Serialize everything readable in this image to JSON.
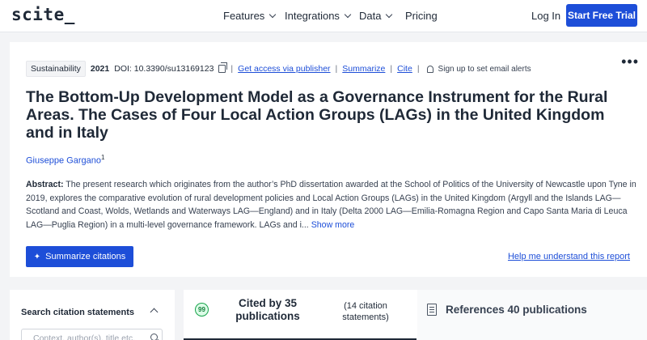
{
  "nav": {
    "logo": "scite_",
    "items": [
      {
        "label": "Features",
        "dropdown": true
      },
      {
        "label": "Integrations",
        "dropdown": true
      },
      {
        "label": "Data",
        "dropdown": true
      },
      {
        "label": "Pricing",
        "dropdown": false
      }
    ],
    "login": "Log In",
    "trial": "Start Free Trial"
  },
  "paper": {
    "category": "Sustainability",
    "year": "2021",
    "doi": "DOI: 10.3390/su13169123",
    "access_link": "Get access via publisher",
    "summarize_link": "Summarize",
    "cite_link": "Cite",
    "alert_text": "Sign up to set email alerts",
    "title": "The Bottom-Up Development Model as a Governance Instrument for the Rural Areas. The Cases of Four Local Action Groups (LAGs) in the United Kingdom and in Italy",
    "author": "Giuseppe Gargano",
    "author_sup": "1",
    "abstract_label": "Abstract:",
    "abstract_text": "The present research which originates from the author’s PhD dissertation awarded at the School of Politics of the University of Newcastle upon Tyne in 2019, explores the comparative evolution of rural development policies and Local Action Groups (LAGs) in the United Kingdom (Argyll and the Islands LAG—Scotland and Coast, Wolds, Wetlands and Waterways LAG—England) and in Italy (Delta 2000 LAG—Emilia-Romagna Region and Capo Santa Maria di Leuca LAG—Puglia Region) in a multi-level governance framework. LAGs and i...",
    "show_more": "Show more",
    "summarize_button": "Summarize citations",
    "help_link": "Help me understand this report"
  },
  "search": {
    "title": "Search citation statements",
    "placeholder": "Context, author(s), title etc."
  },
  "tabs": {
    "cited_label": "Cited by 35 publications",
    "cited_sub": "(14 citation statements)",
    "refs_label": "References 40 publications"
  },
  "colors": {
    "accent": "#1d4ed8",
    "text": "#1f2937",
    "background": "#f3f4f6"
  },
  "icons": [
    "copy-icon",
    "bell-icon",
    "more-icon",
    "chevron-down-icon",
    "search-icon",
    "quote-icon",
    "document-icon",
    "sparkle-icon"
  ]
}
